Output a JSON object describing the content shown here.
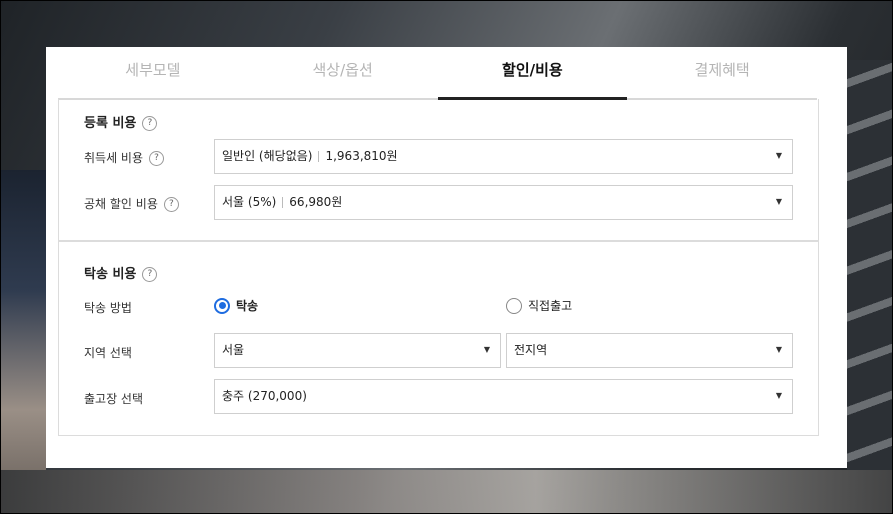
{
  "tabs": [
    {
      "label": "세부모델",
      "active": false
    },
    {
      "label": "색상/옵션",
      "active": false
    },
    {
      "label": "할인/비용",
      "active": true
    },
    {
      "label": "결제혜택",
      "active": false
    }
  ],
  "registration": {
    "title": "등록 비용",
    "help": "?",
    "acquisition_tax": {
      "label": "취득세 비용",
      "help": "?",
      "option": "일반인 (해당없음)",
      "amount": "1,963,810원"
    },
    "bond_discount": {
      "label": "공채 할인 비용",
      "help": "?",
      "option": "서울 (5%)",
      "amount": "66,980원"
    }
  },
  "delivery": {
    "title": "탁송 비용",
    "help": "?",
    "method": {
      "label": "탁송 방법",
      "options": [
        {
          "label": "탁송",
          "selected": true
        },
        {
          "label": "직접출고",
          "selected": false
        }
      ]
    },
    "region": {
      "label": "지역 선택",
      "primary": "서울",
      "secondary": "전지역"
    },
    "depot": {
      "label": "출고장 선택",
      "value": "충주 (270,000)"
    }
  },
  "icons": {
    "dropdown": "caret-down-icon",
    "help": "question-circle-icon"
  },
  "colors": {
    "accent": "#1e6ce0",
    "active_tab_border": "#222222"
  }
}
